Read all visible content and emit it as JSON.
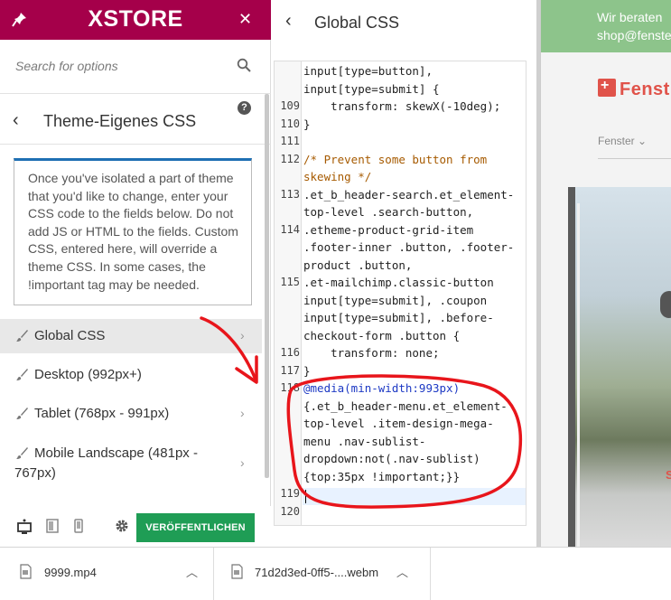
{
  "app": {
    "brand": "XSTORE",
    "close_label": "✕"
  },
  "search": {
    "placeholder": "Search for options"
  },
  "section": {
    "title": "Theme-Eigenes CSS",
    "help": "?",
    "description": "Once you've isolated a part of theme that you'd like to change, enter your CSS code to the fields below. Do not add JS or HTML to the fields. Custom CSS, entered here, will override a theme CSS. In some cases, the !important tag may be needed."
  },
  "menu": [
    {
      "label": "Global CSS",
      "active": true
    },
    {
      "label": "Desktop (992px+)"
    },
    {
      "label": "Tablet (768px - 991px)"
    },
    {
      "label": "Mobile Landscape (481px - 767px)"
    }
  ],
  "footer": {
    "publish_label": "VERÖFFENTLICHEN"
  },
  "editor": {
    "title": "Global CSS",
    "lines": [
      {
        "num": "",
        "text": "input[type=button],"
      },
      {
        "num": "",
        "text": "input[type=submit] {"
      },
      {
        "num": "109",
        "text": "    transform: skewX(-10deg);"
      },
      {
        "num": "110",
        "text": "}"
      },
      {
        "num": "111",
        "text": ""
      },
      {
        "num": "112",
        "text": "/* Prevent some button from"
      },
      {
        "num": "",
        "text": "skewing */"
      },
      {
        "num": "113",
        "text": ".et_b_header-search.et_element-"
      },
      {
        "num": "",
        "text": "top-level .search-button,"
      },
      {
        "num": "114",
        "text": ".etheme-product-grid-item"
      },
      {
        "num": "",
        "text": ".footer-inner .button, .footer-"
      },
      {
        "num": "",
        "text": "product .button,"
      },
      {
        "num": "115",
        "text": ".et-mailchimp.classic-button"
      },
      {
        "num": "",
        "text": "input[type=submit], .coupon"
      },
      {
        "num": "",
        "text": "input[type=submit], .before-"
      },
      {
        "num": "",
        "text": "checkout-form .button {"
      },
      {
        "num": "116",
        "text": "    transform: none;"
      },
      {
        "num": "117",
        "text": "}"
      },
      {
        "num": "118",
        "text": "@media(min-width:993px)"
      },
      {
        "num": "",
        "text": "{.et_b_header-menu.et_element-"
      },
      {
        "num": "",
        "text": "top-level .item-design-mega-"
      },
      {
        "num": "",
        "text": "menu .nav-sublist-"
      },
      {
        "num": "",
        "text": "dropdown:not(.nav-sublist)"
      },
      {
        "num": "",
        "text": "{top:35px !important;}}"
      },
      {
        "num": "119",
        "text": ""
      },
      {
        "num": "120",
        "text": ""
      }
    ]
  },
  "preview": {
    "banner_line1": "Wir beraten",
    "banner_line2": "shop@fenste",
    "logo_text": "Fenst",
    "nav_item": "Fenster ⌄",
    "hero_letter": "S"
  },
  "downloads": [
    {
      "name": "9999.mp4"
    },
    {
      "name": "71d2d3ed-0ff5-....webm"
    }
  ],
  "colors": {
    "topbar": "#a5004a",
    "publish": "#1f9d55",
    "annotation": "#e8151b",
    "banner": "#8dc48b",
    "logo": "#e0534a"
  }
}
